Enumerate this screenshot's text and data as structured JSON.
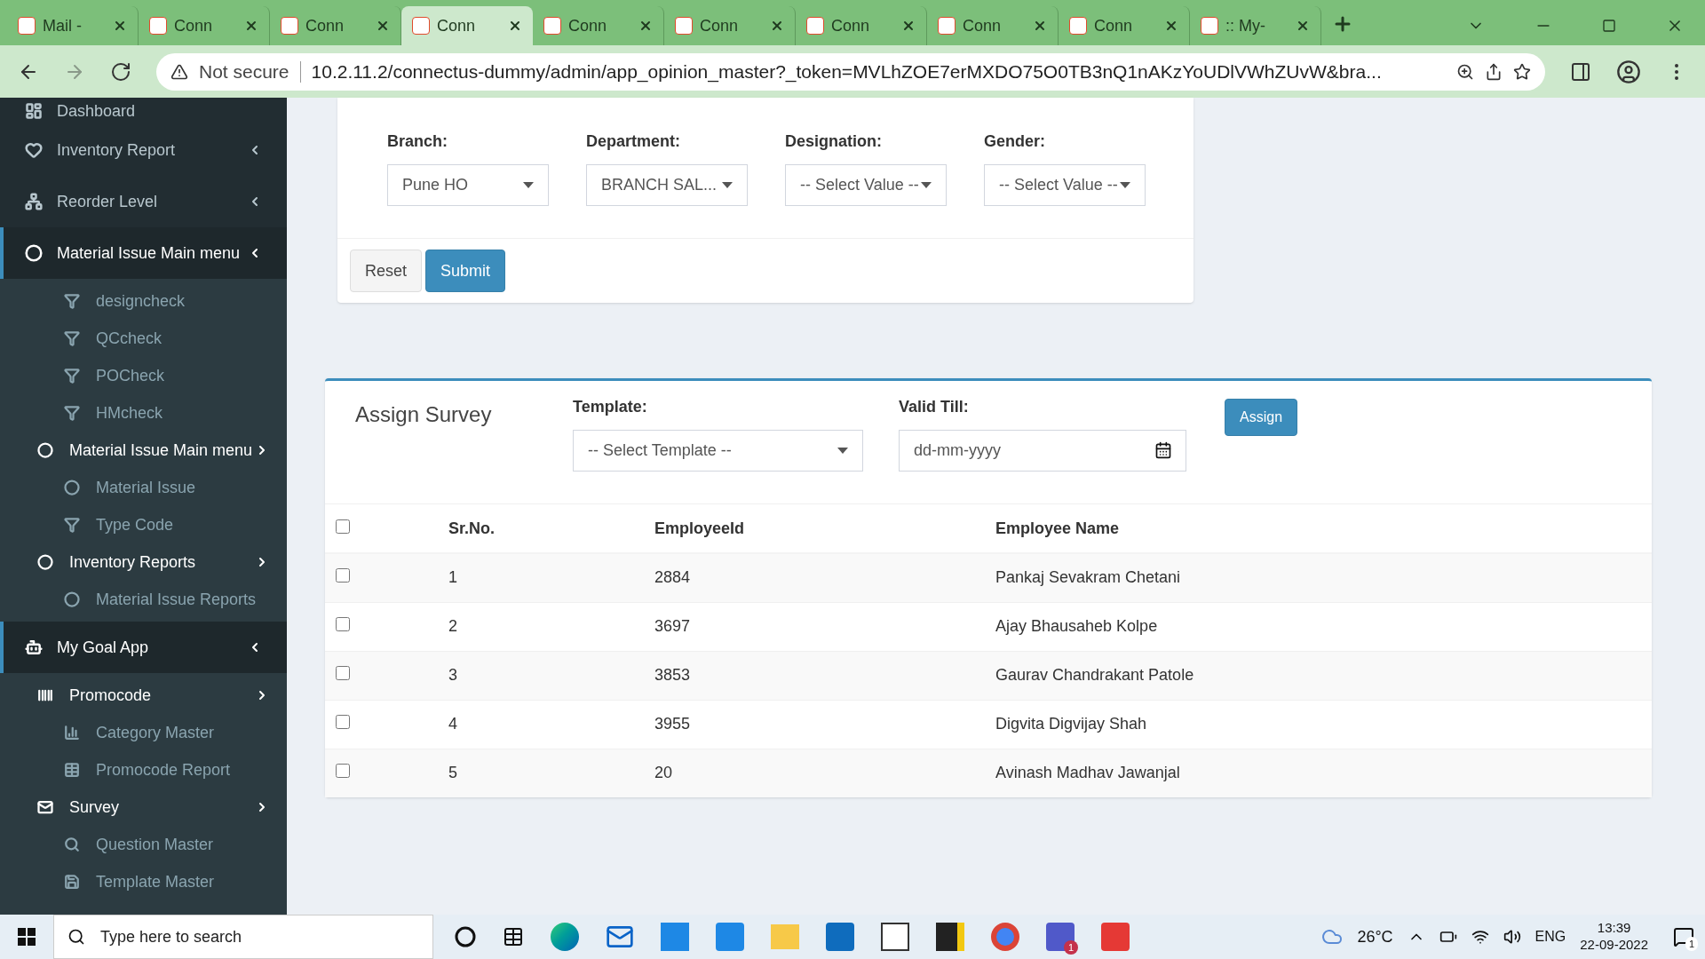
{
  "browser": {
    "tabs": [
      {
        "title": "Mail -",
        "selected": false
      },
      {
        "title": "Conn",
        "selected": false
      },
      {
        "title": "Conn",
        "selected": false
      },
      {
        "title": "Conn",
        "selected": true
      },
      {
        "title": "Conn",
        "selected": false
      },
      {
        "title": "Conn",
        "selected": false
      },
      {
        "title": "Conn",
        "selected": false
      },
      {
        "title": "Conn",
        "selected": false
      },
      {
        "title": "Conn",
        "selected": false
      },
      {
        "title": ":: My-",
        "selected": false
      }
    ],
    "security": "Not secure",
    "url": "10.2.11.2/connectus-dummy/admin/app_opinion_master?_token=MVLhZOE7erMXDO75O0TB3nQ1nAKzYoUDlVWhZUvW&bra..."
  },
  "sidebar": {
    "items": [
      {
        "label": "Dashboard",
        "active": false
      },
      {
        "label": "Inventory Report",
        "active": false
      },
      {
        "label": "Reorder Level",
        "active": false
      },
      {
        "label": "Material Issue Main menu",
        "active": true,
        "children": [
          {
            "label": "designcheck"
          },
          {
            "label": "QCcheck"
          },
          {
            "label": "POCheck"
          },
          {
            "label": "HMcheck"
          },
          {
            "label": "Material Issue Main menu",
            "children": [
              {
                "label": "Material Issue"
              },
              {
                "label": "Type Code"
              }
            ]
          },
          {
            "label": "Inventory Reports",
            "children": [
              {
                "label": "Material Issue Reports"
              }
            ]
          }
        ]
      },
      {
        "label": "My Goal App",
        "active": true,
        "children": [
          {
            "label": "Promocode",
            "children": [
              {
                "label": "Category Master"
              },
              {
                "label": "Promocode Report"
              }
            ]
          },
          {
            "label": "Survey",
            "children": [
              {
                "label": "Question Master"
              },
              {
                "label": "Template Master"
              }
            ]
          }
        ]
      }
    ]
  },
  "filter": {
    "fields": [
      {
        "label": "Branch:",
        "value": "Pune HO"
      },
      {
        "label": "Department:",
        "value": "BRANCH SAL..."
      },
      {
        "label": "Designation:",
        "value": "-- Select Value --"
      },
      {
        "label": "Gender:",
        "value": "-- Select Value --"
      }
    ],
    "buttons": [
      "Reset",
      "Submit"
    ]
  },
  "assign": {
    "title": "Assign Survey",
    "template_label": "Template:",
    "template_value": "-- Select Template --",
    "valid_label": "Valid Till:",
    "valid_placeholder": "dd-mm-yyyy",
    "button": "Assign",
    "table": {
      "select_all": false,
      "columns": [
        "Sr.No.",
        "EmployeeId",
        "Employee Name"
      ],
      "rows": [
        {
          "checked": false,
          "cells": [
            "1",
            "2884",
            "Pankaj Sevakram Chetani"
          ]
        },
        {
          "checked": false,
          "cells": [
            "2",
            "3697",
            "Ajay Bhausaheb Kolpe"
          ]
        },
        {
          "checked": false,
          "cells": [
            "3",
            "3853",
            "Gaurav Chandrakant Patole"
          ]
        },
        {
          "checked": false,
          "cells": [
            "4",
            "3955",
            "Digvita Digvijay Shah"
          ]
        },
        {
          "checked": false,
          "cells": [
            "5",
            "20",
            "Avinash Madhav Jawanjal"
          ]
        }
      ]
    }
  },
  "taskbar": {
    "search_placeholder": "Type here to search",
    "temperature": "26°C",
    "language": "ENG",
    "time": "13:39",
    "date": "22-09-2022",
    "notifications": "1",
    "teams_badge": "1"
  }
}
